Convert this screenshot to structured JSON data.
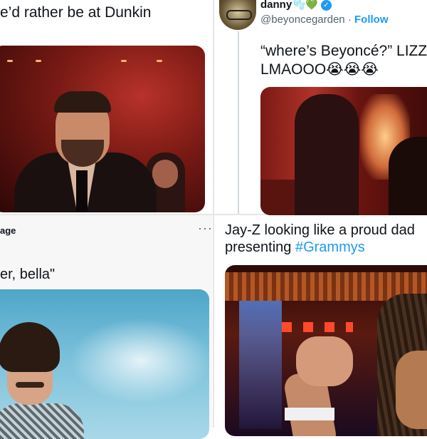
{
  "panel_top_left": {
    "tweet_text": "e’d rather be at Dunkin"
  },
  "panel_top_right": {
    "display_name": "danny",
    "name_emojis": "🫧💚",
    "verified_glyph": "✓",
    "handle": "@beyoncegarden",
    "separator": "·",
    "follow_label": "Follow",
    "tweet_line1": "“where’s Beyoncé?” LIZZ",
    "tweet_line2": "LMAOOO😭😭😭"
  },
  "panel_bottom_left": {
    "handle_fragment": "age",
    "more_glyph": "···",
    "tweet_text": "er, bella\""
  },
  "panel_bottom_right": {
    "tweet_line1": "Jay-Z looking like a proud dad",
    "tweet_line2_prefix": "presenting ",
    "hashtag": "#Grammys"
  },
  "icons": {
    "verified": "verified-badge-icon",
    "more": "more-options-icon"
  },
  "colors": {
    "link_blue": "#1d9bf0",
    "secondary_text": "#536471",
    "primary_text": "#0f1419"
  }
}
